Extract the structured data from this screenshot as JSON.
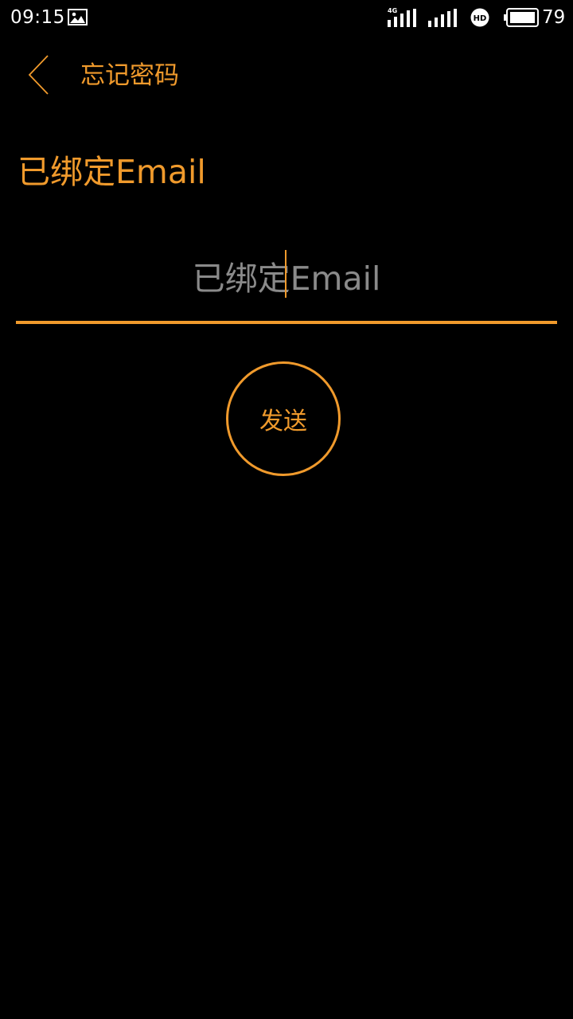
{
  "status_bar": {
    "time": "09:15",
    "network_type": "4G",
    "battery_level": "79",
    "icons": [
      "gallery-icon",
      "signal-icon",
      "signal-icon",
      "hd-icon",
      "battery-icon"
    ]
  },
  "header": {
    "back_icon": "chevron-left-icon",
    "title": "忘记密码"
  },
  "form": {
    "section_label": "已绑定Email",
    "email_input": {
      "value": "",
      "placeholder": "已绑定Email"
    },
    "send_button_label": "发送"
  },
  "colors": {
    "background": "#000000",
    "accent": "#f09a2c",
    "placeholder": "#8a8a8a",
    "status_text": "#ffffff"
  }
}
